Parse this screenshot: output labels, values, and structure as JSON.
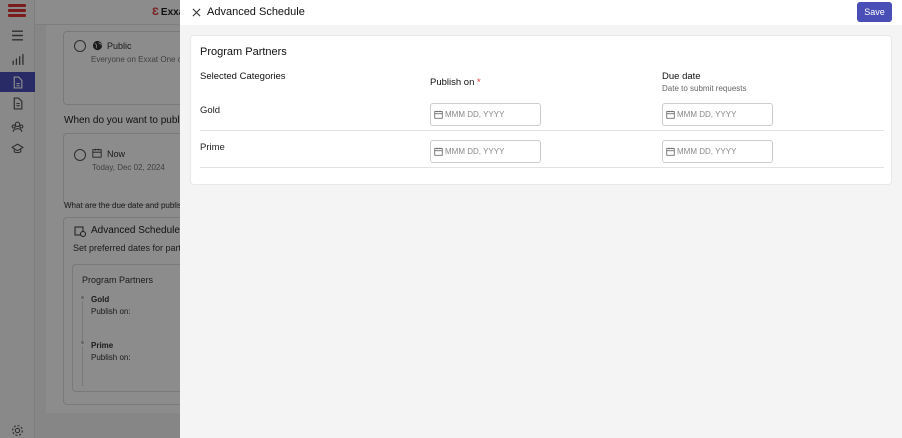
{
  "background": {
    "brand": "Exxat",
    "visibility": {
      "option_label": "Public",
      "option_desc": "Everyone on Exxat One ca"
    },
    "publish_question": "When do you want to publish",
    "publish_option": {
      "label": "Now",
      "date": "Today, Dec 02, 2024"
    },
    "due_question": "What are the due date and publish",
    "advanced": {
      "title": "Advanced Schedule",
      "subtitle": "Set preferred dates for part",
      "partners_title": "Program Partners",
      "items": [
        {
          "name": "Gold",
          "publish_label": "Publish on:"
        },
        {
          "name": "Prime",
          "publish_label": "Publish on:"
        }
      ]
    }
  },
  "drawer": {
    "title": "Advanced Schedule",
    "save_label": "Save",
    "panel_title": "Program Partners",
    "columns": {
      "category": "Selected Categories",
      "publish": "Publish on",
      "required_mark": "*",
      "due": "Due date",
      "due_sub": "Date to submit requests"
    },
    "rows": [
      {
        "category": "Gold",
        "publish_placeholder": "MMM DD, YYYY",
        "due_placeholder": "MMM DD, YYYY"
      },
      {
        "category": "Prime",
        "publish_placeholder": "MMM DD, YYYY",
        "due_placeholder": "MMM DD, YYYY"
      }
    ]
  },
  "colors": {
    "accent": "#4a4fb8",
    "brand_red": "#e03434"
  },
  "icons": [
    "menu-icon",
    "chart-icon",
    "document-icon",
    "file-icon",
    "users-icon",
    "graduation-icon",
    "settings-icon",
    "globe-icon",
    "calendar-icon",
    "schedule-icon",
    "close-icon"
  ]
}
